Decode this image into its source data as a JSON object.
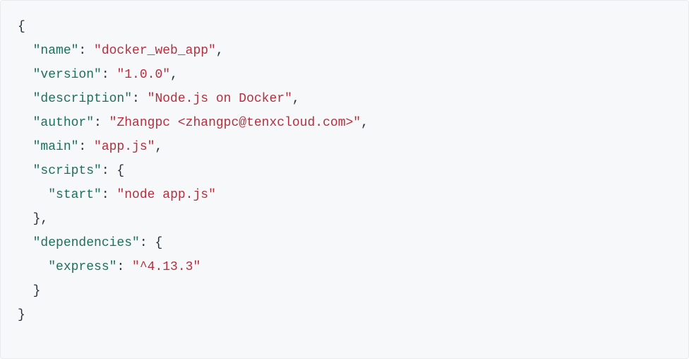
{
  "code": {
    "l1": "{",
    "l2": {
      "indent": "  ",
      "key": "\"name\"",
      "sep": ": ",
      "val": "\"docker_web_app\"",
      "tail": ","
    },
    "l3": {
      "indent": "  ",
      "key": "\"version\"",
      "sep": ": ",
      "val": "\"1.0.0\"",
      "tail": ","
    },
    "l4": {
      "indent": "  ",
      "key": "\"description\"",
      "sep": ": ",
      "val": "\"Node.js on Docker\"",
      "tail": ","
    },
    "l5": {
      "indent": "  ",
      "key": "\"author\"",
      "sep": ": ",
      "val": "\"Zhangpc <zhangpc@tenxcloud.com>\"",
      "tail": ","
    },
    "l6": {
      "indent": "  ",
      "key": "\"main\"",
      "sep": ": ",
      "val": "\"app.js\"",
      "tail": ","
    },
    "l7": {
      "indent": "  ",
      "key": "\"scripts\"",
      "sep": ": {",
      "val": "",
      "tail": ""
    },
    "l8": {
      "indent": "    ",
      "key": "\"start\"",
      "sep": ": ",
      "val": "\"node app.js\"",
      "tail": ""
    },
    "l9": "  },",
    "l10": {
      "indent": "  ",
      "key": "\"dependencies\"",
      "sep": ": {",
      "val": "",
      "tail": ""
    },
    "l11": {
      "indent": "    ",
      "key": "\"express\"",
      "sep": ": ",
      "val": "\"^4.13.3\"",
      "tail": ""
    },
    "l12": "  }",
    "l13": "}"
  }
}
